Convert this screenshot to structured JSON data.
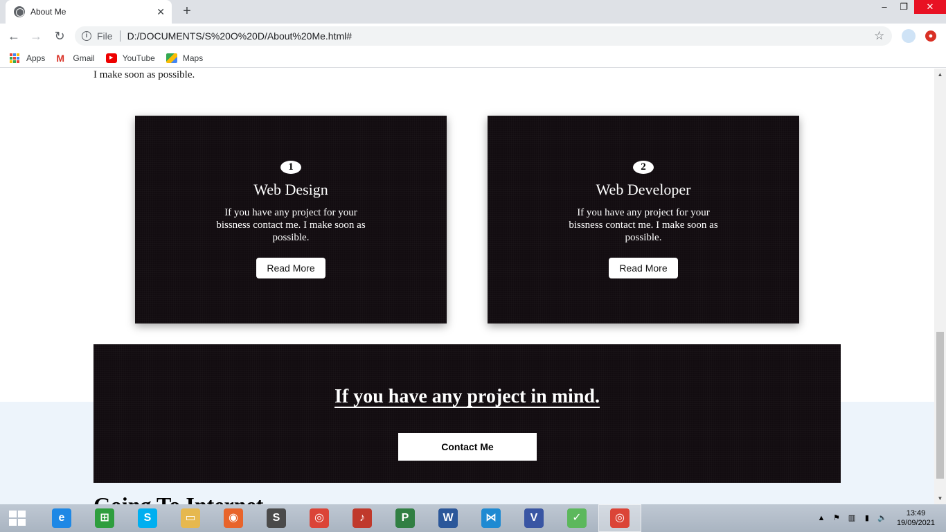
{
  "browser": {
    "tab_title": "About Me",
    "new_tab": "+",
    "close_tab": "✕",
    "address_scheme": "File",
    "address_url": "D:/DOCUMENTS/S%20O%20D/About%20Me.html#",
    "window_controls": {
      "minimize": "–",
      "restore": "❐",
      "close": "✕"
    }
  },
  "bookmarks": [
    {
      "label": "Apps",
      "icon": "apps-icon"
    },
    {
      "label": "Gmail",
      "icon": "gmail-icon"
    },
    {
      "label": "YouTube",
      "icon": "youtube-icon"
    },
    {
      "label": "Maps",
      "icon": "maps-icon"
    }
  ],
  "page": {
    "top_text": "I make soon as possible.",
    "cards": [
      {
        "number": "1",
        "title": "Web Design",
        "text": "If you have any project for your bissness contact me. I make soon as possible.",
        "button": "Read More"
      },
      {
        "number": "2",
        "title": "Web Developer",
        "text": "If you have any project for your bissness contact me. I make soon as possible.",
        "button": "Read More"
      }
    ],
    "banner": {
      "title": "If you have any project in mind.",
      "button": "Contact Me"
    },
    "next_heading": "Going To Internet"
  },
  "taskbar": {
    "apps": [
      {
        "name": "internet-explorer-icon",
        "color": "#1e88e5",
        "glyph": "e"
      },
      {
        "name": "store-icon",
        "color": "#2e9e3e",
        "glyph": "⊞"
      },
      {
        "name": "skype-icon",
        "color": "#00aff0",
        "glyph": "S"
      },
      {
        "name": "file-explorer-icon",
        "color": "#e6b84f",
        "glyph": "▭"
      },
      {
        "name": "firefox-icon",
        "color": "#e8642b",
        "glyph": "◉"
      },
      {
        "name": "sublime-text-icon",
        "color": "#4a4a4a",
        "glyph": "S"
      },
      {
        "name": "chrome-icon",
        "color": "#db4437",
        "glyph": "◎"
      },
      {
        "name": "speaker-icon",
        "color": "#c0392b",
        "glyph": "♪"
      },
      {
        "name": "project-icon",
        "color": "#317f43",
        "glyph": "P"
      },
      {
        "name": "word-icon",
        "color": "#2b579a",
        "glyph": "W"
      },
      {
        "name": "vscode-icon",
        "color": "#1f8ad2",
        "glyph": "⋈"
      },
      {
        "name": "visio-icon",
        "color": "#3955a3",
        "glyph": "V"
      },
      {
        "name": "green-app-icon",
        "color": "#5cb85c",
        "glyph": "✓"
      },
      {
        "name": "chrome-active-icon",
        "color": "#db4437",
        "glyph": "◎"
      }
    ],
    "clock_time": "13:49",
    "clock_date": "19/09/2021"
  }
}
